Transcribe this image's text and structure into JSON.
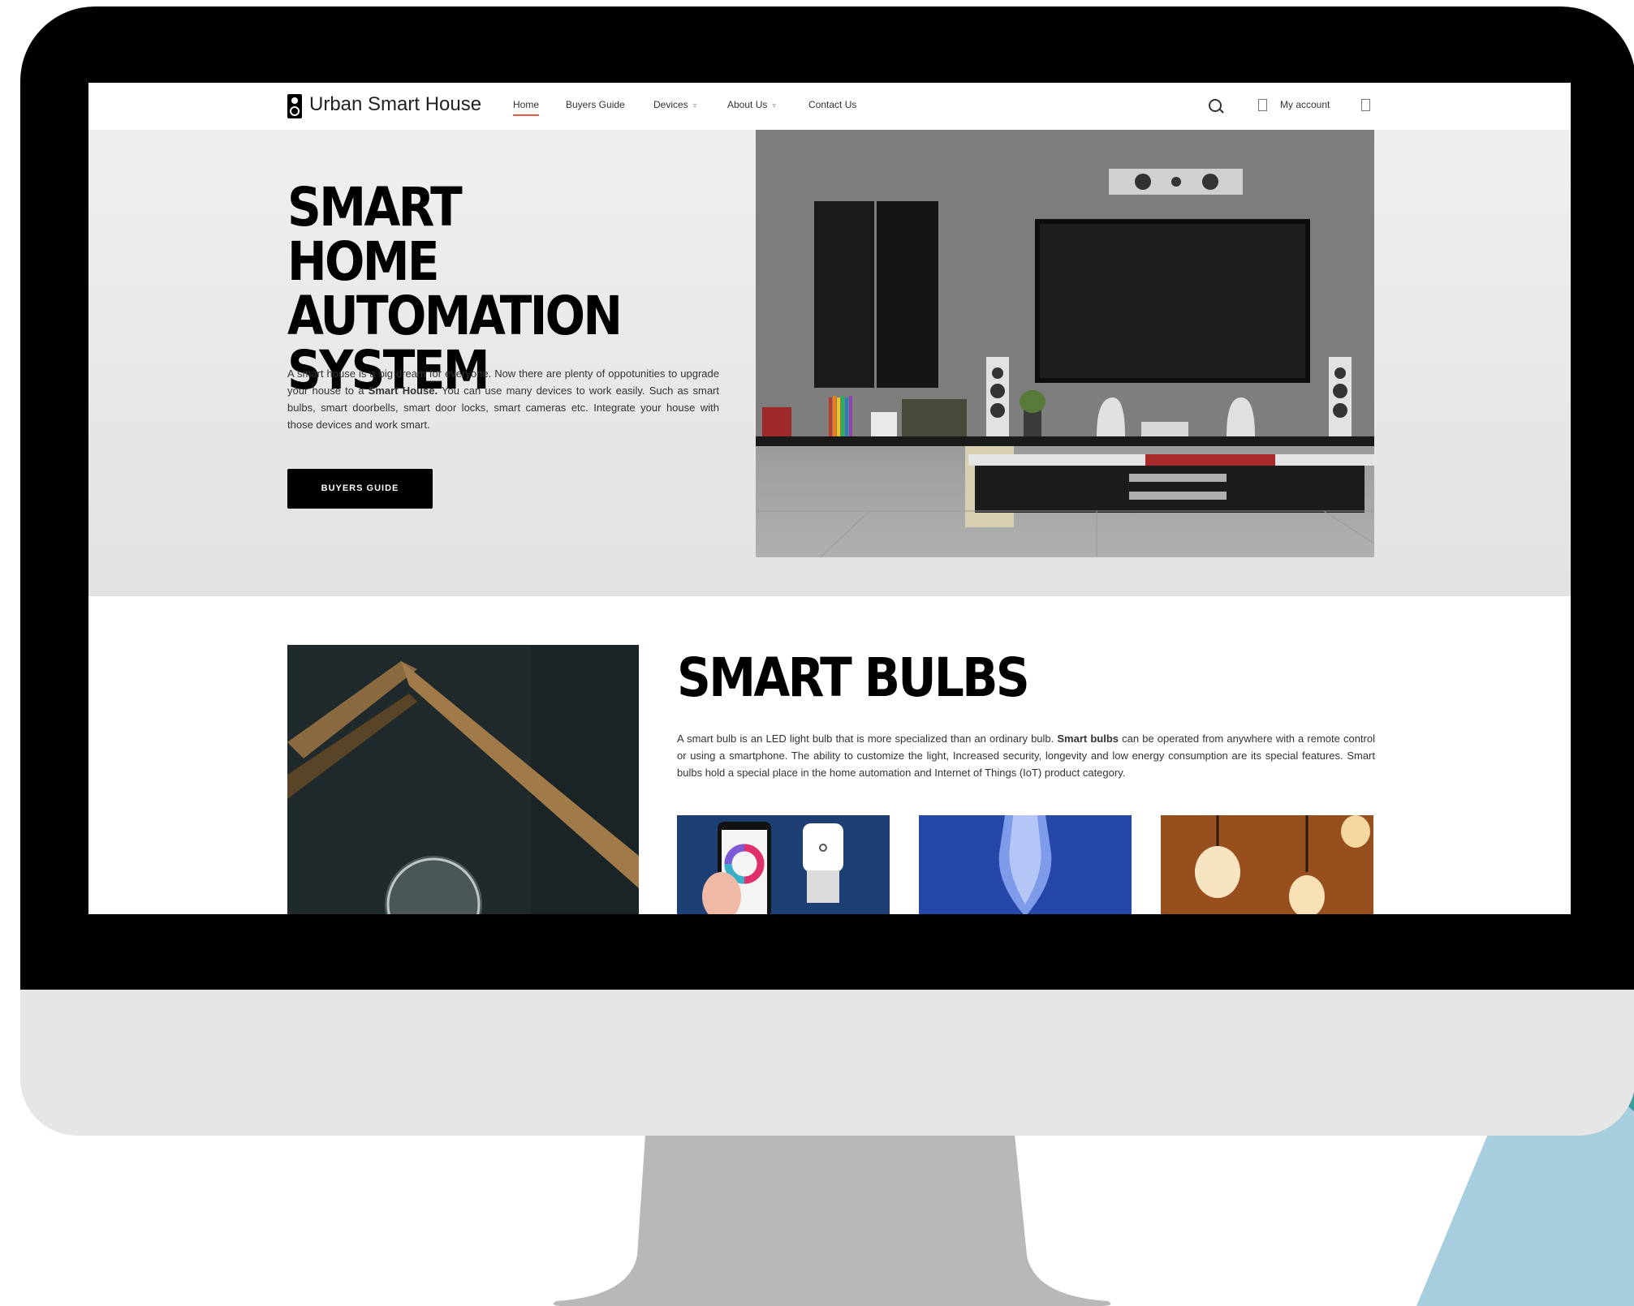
{
  "site": {
    "logo_text": "Urban Smart House",
    "nav": [
      {
        "label": "Home",
        "active": true,
        "has_dropdown": false
      },
      {
        "label": "Buyers Guide",
        "active": false,
        "has_dropdown": false
      },
      {
        "label": "Devices",
        "active": false,
        "has_dropdown": true
      },
      {
        "label": "About Us",
        "active": false,
        "has_dropdown": true
      },
      {
        "label": "Contact Us",
        "active": false,
        "has_dropdown": false
      }
    ],
    "account_label": "My account"
  },
  "hero": {
    "title": "SMART HOME AUTOMATION SYSTEM",
    "text_before": "A smart house is a big dream for everyone. Now there are plenty of oppotunities to upgrade your house to a ",
    "text_bold": "Smart House.",
    "text_after": " You can use many devices to work easily. Such as smart bulbs, smart doorbells, smart door locks, smart cameras etc. Integrate your house with those devices and work smart.",
    "button_label": "BUYERS GUIDE"
  },
  "bulbs": {
    "title": "SMART BULBS",
    "text_before": "A smart bulb is an LED light bulb that is more specialized than an ordinary bulb. ",
    "text_bold": "Smart bulbs",
    "text_after": " can be operated from anywhere with a remote control or using a smartphone. The ability to customize the light, Increased security, longevity and low energy consumption are its special features. Smart bulbs hold a special place in the home automation and Internet of Things (IoT) product category."
  },
  "colors": {
    "accent": "#e9574a",
    "teal": "#3a9b9b",
    "light_blue": "#a7cede",
    "bezel": "#000000",
    "chin": "#e6e6e6",
    "stand": "#b8b8b8"
  }
}
